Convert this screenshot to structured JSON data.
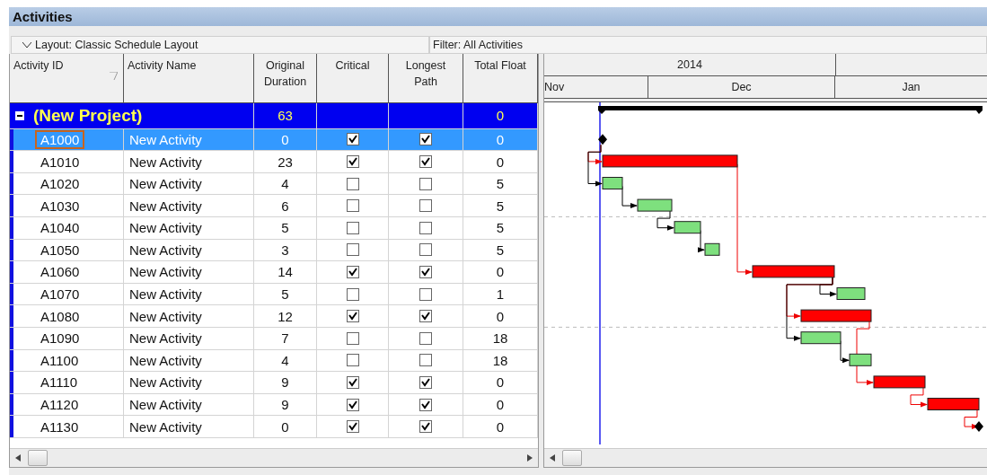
{
  "panel": {
    "title": "Activities"
  },
  "toolbar": {
    "layout": "Layout: Classic Schedule Layout",
    "filter": "Filter: All Activities"
  },
  "columns": [
    {
      "label": "Activity ID",
      "sorted": true
    },
    {
      "label": "Activity Name",
      "sorted": false
    },
    {
      "label": "Original Duration",
      "sorted": false
    },
    {
      "label": "Critical",
      "sorted": false
    },
    {
      "label": "Longest Path",
      "sorted": false
    },
    {
      "label": "Total Float",
      "sorted": false
    }
  ],
  "project": {
    "name": "(New Project)",
    "duration": "63",
    "total_float": "0",
    "expanded": true
  },
  "activities": [
    {
      "id": "A1000",
      "name": "New Activity",
      "duration": "0",
      "critical": true,
      "longest_path": true,
      "total_float": "0",
      "selected": true
    },
    {
      "id": "A1010",
      "name": "New Activity",
      "duration": "23",
      "critical": true,
      "longest_path": true,
      "total_float": "0",
      "selected": false
    },
    {
      "id": "A1020",
      "name": "New Activity",
      "duration": "4",
      "critical": false,
      "longest_path": false,
      "total_float": "5",
      "selected": false
    },
    {
      "id": "A1030",
      "name": "New Activity",
      "duration": "6",
      "critical": false,
      "longest_path": false,
      "total_float": "5",
      "selected": false
    },
    {
      "id": "A1040",
      "name": "New Activity",
      "duration": "5",
      "critical": false,
      "longest_path": false,
      "total_float": "5",
      "selected": false
    },
    {
      "id": "A1050",
      "name": "New Activity",
      "duration": "3",
      "critical": false,
      "longest_path": false,
      "total_float": "5",
      "selected": false
    },
    {
      "id": "A1060",
      "name": "New Activity",
      "duration": "14",
      "critical": true,
      "longest_path": true,
      "total_float": "0",
      "selected": false
    },
    {
      "id": "A1070",
      "name": "New Activity",
      "duration": "5",
      "critical": false,
      "longest_path": false,
      "total_float": "1",
      "selected": false
    },
    {
      "id": "A1080",
      "name": "New Activity",
      "duration": "12",
      "critical": true,
      "longest_path": true,
      "total_float": "0",
      "selected": false
    },
    {
      "id": "A1090",
      "name": "New Activity",
      "duration": "7",
      "critical": false,
      "longest_path": false,
      "total_float": "18",
      "selected": false
    },
    {
      "id": "A1100",
      "name": "New Activity",
      "duration": "4",
      "critical": false,
      "longest_path": false,
      "total_float": "18",
      "selected": false
    },
    {
      "id": "A1110",
      "name": "New Activity",
      "duration": "9",
      "critical": true,
      "longest_path": true,
      "total_float": "0",
      "selected": false
    },
    {
      "id": "A1120",
      "name": "New Activity",
      "duration": "9",
      "critical": true,
      "longest_path": true,
      "total_float": "0",
      "selected": false
    },
    {
      "id": "A1130",
      "name": "New Activity",
      "duration": "0",
      "critical": true,
      "longest_path": true,
      "total_float": "0",
      "selected": false
    }
  ],
  "timescale": {
    "year": "2014",
    "months": [
      "Nov",
      "Dec",
      "Jan"
    ]
  }
}
